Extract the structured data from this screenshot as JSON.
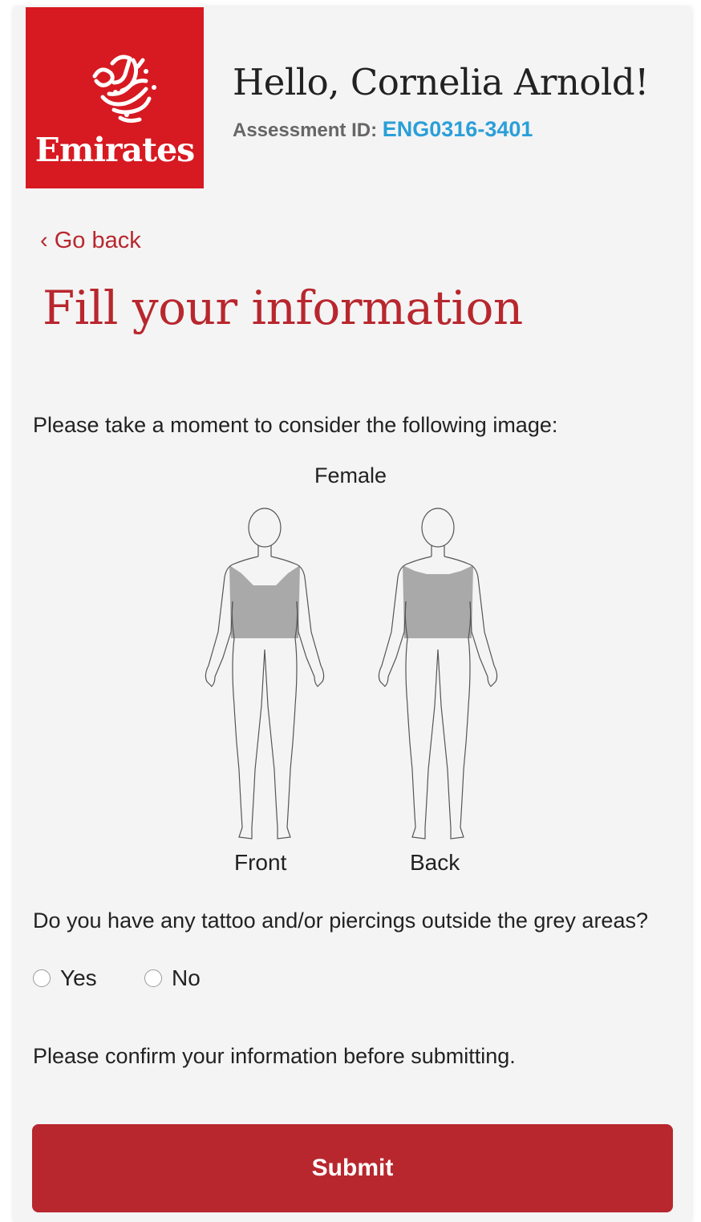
{
  "brand": {
    "name": "Emirates",
    "color": "#d71921",
    "logo_icon": "emirates-logo-icon"
  },
  "header": {
    "greeting": "Hello, Cornelia Arnold!",
    "assessment_label": "Assessment ID:",
    "assessment_id": "ENG0316-3401",
    "assessment_id_color": "#2a9fd8"
  },
  "nav": {
    "back_label": "‹ Go back"
  },
  "page": {
    "title": "Fill your information",
    "title_color": "#b8272e"
  },
  "body_figure": {
    "prompt": "Please take a moment to consider the following image:",
    "title": "Female",
    "front_label": "Front",
    "back_label": "Back"
  },
  "tattoo_question": {
    "text": "Do you have any tattoo and/or piercings outside the grey areas?",
    "options": [
      "Yes",
      "No"
    ],
    "selected": null
  },
  "confirm_text": "Please confirm your information before submitting.",
  "submit": {
    "label": "Submit",
    "color": "#b8272e"
  }
}
